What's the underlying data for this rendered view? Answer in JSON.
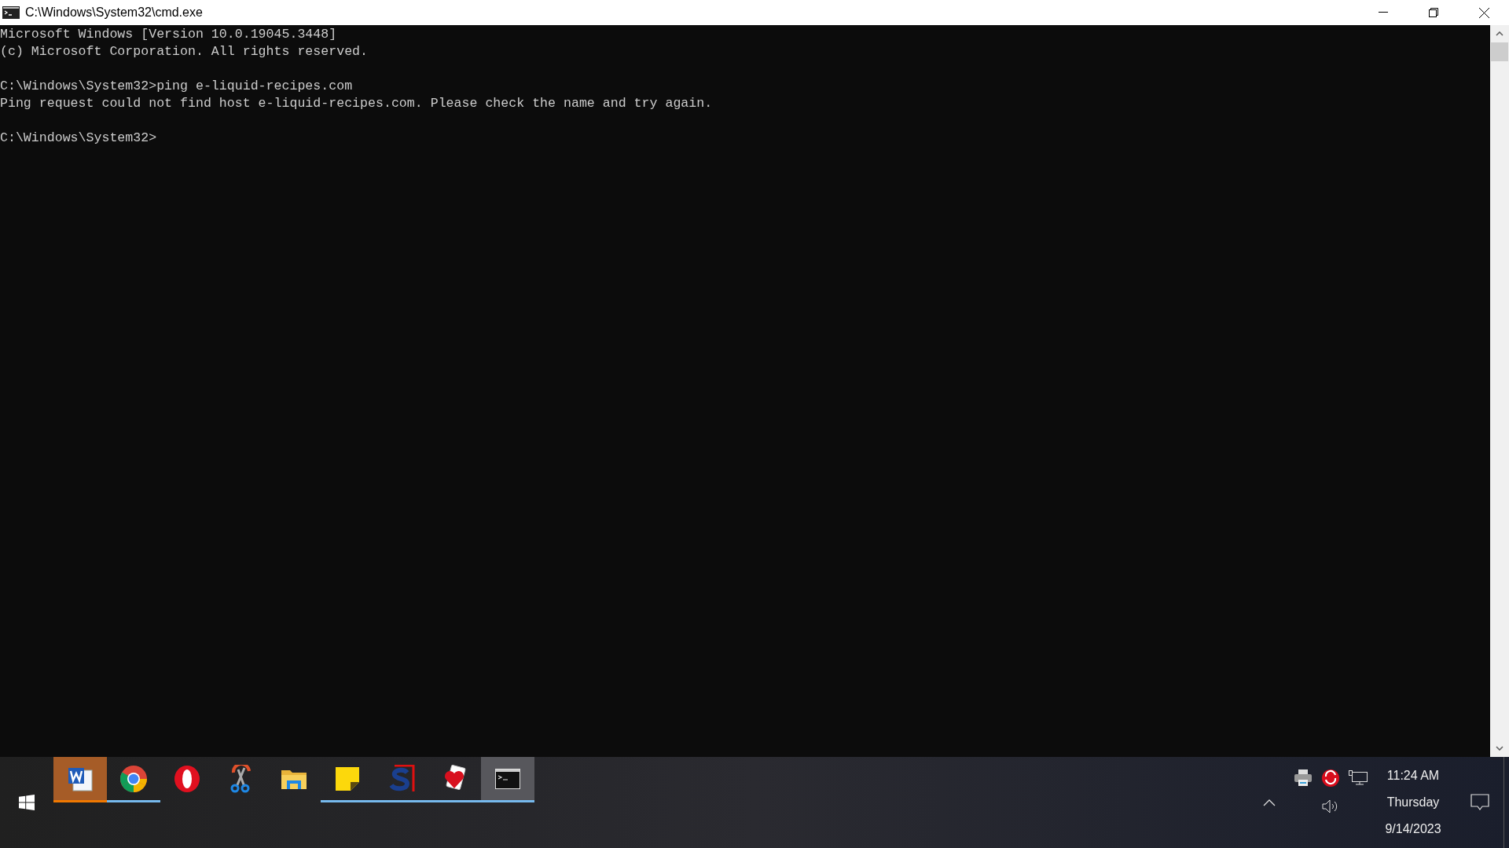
{
  "window": {
    "title": "C:\\Windows\\System32\\cmd.exe"
  },
  "console": {
    "blocks": [
      [
        "Microsoft Windows [Version 10.0.19045.3448]",
        "(c) Microsoft Corporation. All rights reserved."
      ],
      [
        "C:\\Windows\\System32>ping e-liquid-recipes.com",
        "Ping request could not find host e-liquid-recipes.com. Please check the name and try again."
      ],
      [
        "C:\\Windows\\System32>"
      ]
    ]
  },
  "taskbar": {
    "apps": [
      {
        "kind": "word",
        "running": true,
        "selected": false,
        "flashing": true
      },
      {
        "kind": "chrome",
        "running": true,
        "selected": false,
        "flashing": false
      },
      {
        "kind": "opera",
        "running": false,
        "selected": false,
        "flashing": false
      },
      {
        "kind": "snip",
        "running": false,
        "selected": false,
        "flashing": false
      },
      {
        "kind": "folder",
        "running": false,
        "selected": false,
        "flashing": false
      },
      {
        "kind": "notes",
        "running": true,
        "selected": false,
        "flashing": false
      },
      {
        "kind": "sapp",
        "running": true,
        "selected": false,
        "flashing": false
      },
      {
        "kind": "cards",
        "running": true,
        "selected": false,
        "flashing": false
      },
      {
        "kind": "terminal",
        "running": true,
        "selected": true,
        "flashing": false
      }
    ],
    "clock": {
      "time": "11:24 AM",
      "day": "Thursday",
      "date": "9/14/2023"
    }
  }
}
